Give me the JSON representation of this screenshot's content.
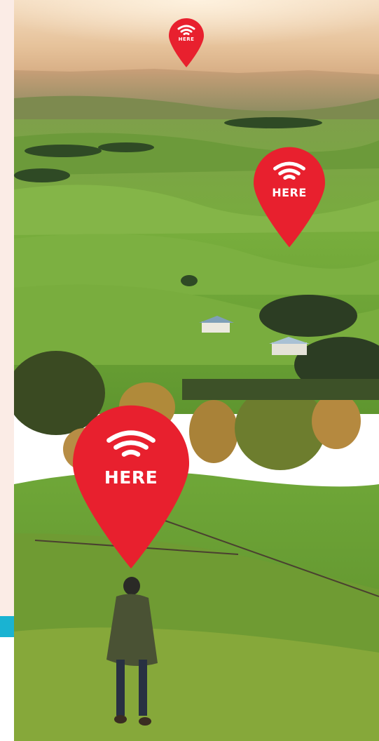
{
  "pins": {
    "small": {
      "label": "HERE"
    },
    "medium": {
      "label": "HERE"
    },
    "large": {
      "label": "HERE"
    }
  },
  "colors": {
    "pin_red": "#e8202e",
    "sidebar_bg": "#fbece6",
    "sidebar_accent": "#1ab3d2",
    "sky": "#e9c9a3",
    "grass": "#6fa53a"
  },
  "icons": {
    "pin_icon": "wifi-icon"
  }
}
